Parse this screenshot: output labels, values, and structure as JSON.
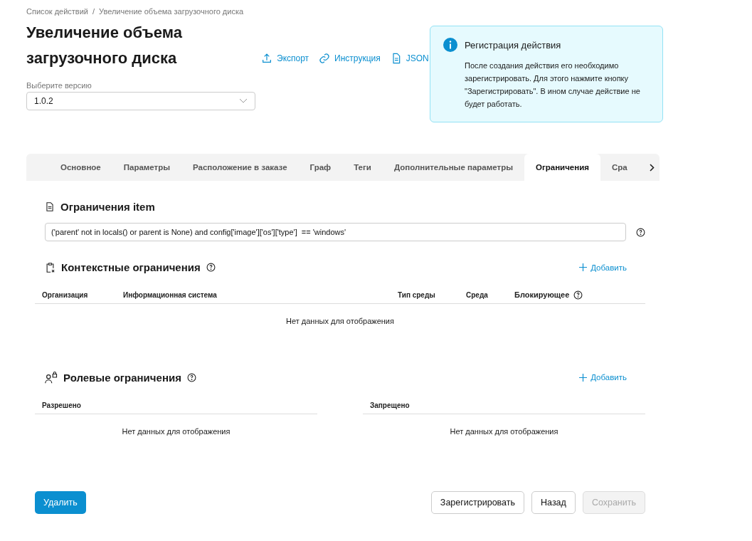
{
  "breadcrumbs": [
    {
      "label": "Список действий"
    },
    {
      "label": "Увеличение объема загрузочного диска"
    }
  ],
  "breadcrumb_separator": "/",
  "title": "Увеличение объема загрузочного диска",
  "header_links": [
    {
      "kind": "export",
      "label": "Экспорт"
    },
    {
      "kind": "link",
      "label": "Инструкция"
    },
    {
      "kind": "file",
      "label": "JSON"
    }
  ],
  "version_select": {
    "label": "Выберите версию",
    "value": "1.0.2"
  },
  "notice": {
    "title": "Регистрация действия",
    "text": "После создания действия его необходимо зарегистрировать. Для этого нажмите кнопку \"Зарегистрировать\". В ином случае действие не будет работать."
  },
  "tabs": [
    {
      "label": "Основное",
      "selected": false
    },
    {
      "label": "Параметры",
      "selected": false
    },
    {
      "label": "Расположение в заказе",
      "selected": false
    },
    {
      "label": "Граф",
      "selected": false
    },
    {
      "label": "Теги",
      "selected": false
    },
    {
      "label": "Дополнительные параметры",
      "selected": false
    },
    {
      "label": "Ограничения",
      "selected": true
    },
    {
      "label": "Сра",
      "selected": false
    }
  ],
  "item_restrictions": {
    "title": "Ограничения item",
    "value": "('parent' not in locals() or parent is None) and config['image']['os']['type']  == 'windows'"
  },
  "context_restrictions": {
    "title": "Контекстные ограничения",
    "add": "Добавить",
    "columns": [
      "Организация",
      "Информационная система",
      "Тип среды",
      "Среда",
      "Блокирующее"
    ],
    "empty": "Нет данных для отображения"
  },
  "role_restrictions": {
    "title": "Ролевые ограничения",
    "add": "Добавить",
    "tables": [
      {
        "column": "Разрешено",
        "empty": "Нет данных для отображения"
      },
      {
        "column": "Запрещено",
        "empty": "Нет данных для отображения"
      }
    ]
  },
  "buttons_left": [
    {
      "kind": "primary",
      "label": "Удалить"
    }
  ],
  "buttons_right": [
    {
      "kind": "outline",
      "label": "Зарегистрировать"
    },
    {
      "kind": "outline",
      "label": "Назад"
    },
    {
      "kind": "disabled",
      "label": "Сохранить"
    }
  ]
}
